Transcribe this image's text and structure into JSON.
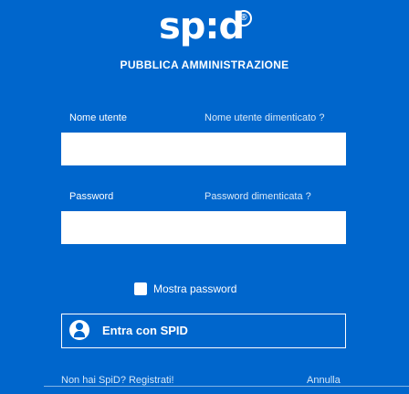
{
  "brand": {
    "logo_text": "sp:d",
    "registered_symbol": "®",
    "subtitle": "PUBBLICA AMMINISTRAZIONE"
  },
  "form": {
    "username": {
      "label": "Nome utente",
      "link": "Nome utente dimenticato ?",
      "value": ""
    },
    "password": {
      "label": "Password",
      "link": "Password dimenticata ?",
      "value": ""
    },
    "show_password_label": "Mostra password",
    "spid_button_label": "Entra con SPID"
  },
  "footer": {
    "register_link": "Non hai SpiD? Registrati!",
    "cancel_link": "Annulla"
  },
  "colors": {
    "background": "#0066cc",
    "text": "#ffffff",
    "input_bg": "#ffffff"
  },
  "icons": {
    "spid_user": "user-icon"
  }
}
